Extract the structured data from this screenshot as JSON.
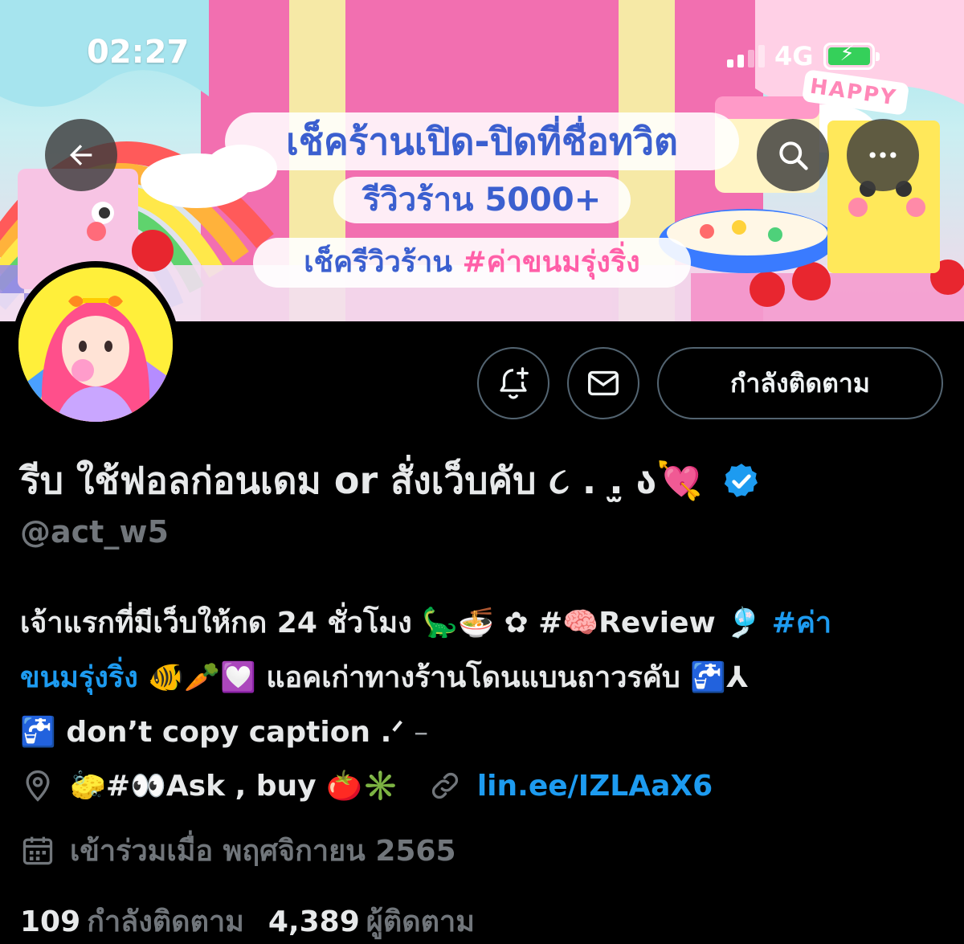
{
  "status_bar": {
    "time": "02:27",
    "network": "4G"
  },
  "banner": {
    "line1": "เช็คร้านเปิด-ปิดที่ชื่อทวิต",
    "line2": "รีวิวร้าน 5000+",
    "line3_prefix": "เช็ครีวิวร้าน",
    "line3_tag": "#ค่าขนมรุ่งริ่ง",
    "sign": "HAPPY"
  },
  "profile": {
    "display_name": "รีบ ใช้ฟอลก่อนเดม or สั่งเว็บคับ ૮ . .̫ ა💘",
    "handle": "@act_w5",
    "bio": {
      "line1_text": "เจ้าแรกที่มีเว็บให้กด 24 ชั่วโมง 🦕🍜 ✿ #🧠Review 🎐",
      "line1_tag": "#ค่า",
      "line2_tag": "ขนมรุ่งริ่ง",
      "line2_text": "🐠🥕💟 แอคเก่าทางร้านโดนแบนถาวรคับ 🚰⅄",
      "line3_text": "🚰 don’t copy caption .ᐟ",
      "line3_tail": "–"
    },
    "location": "🧽#👀Ask , buy 🍅✳️",
    "link": "lin.ee/IZLAaX6",
    "joined": "เข้าร่วมเมื่อ พฤศจิกายน 2565",
    "following_count": "109",
    "following_label": "กำลังติดตาม",
    "followers_count": "4,389",
    "followers_label": "ผู้ติดตาม"
  },
  "actions": {
    "follow_state_label": "กำลังติดตาม"
  },
  "icons": {
    "back": "back-arrow-icon",
    "search": "search-icon",
    "more": "more-icon",
    "notify": "bell-plus-icon",
    "message": "envelope-icon",
    "verified": "verified-badge-icon",
    "location": "location-pin-icon",
    "link": "link-icon",
    "calendar": "calendar-icon"
  },
  "colors": {
    "accent": "#1d9bf0",
    "muted": "#71767b",
    "text": "#e7e9ea",
    "background": "#000000"
  }
}
